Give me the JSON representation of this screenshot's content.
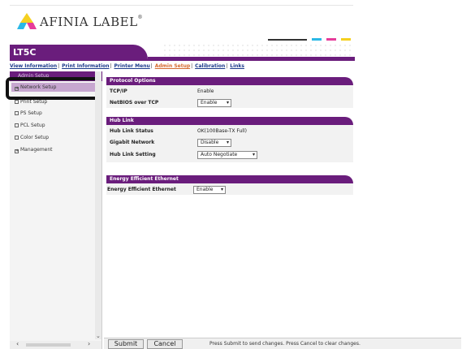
{
  "logo": {
    "text": "AFINIA LABEL",
    "tm": "®"
  },
  "header": {
    "title": "LT5C"
  },
  "colors": {
    "brand": "#6a1d7c",
    "selected": "#c7a7d0",
    "active_link": "#d46a2e",
    "cyan": "#2bb8e6",
    "magenta": "#e63c9a",
    "yellow": "#f5d020"
  },
  "topnav": {
    "items": [
      {
        "label": "View Information"
      },
      {
        "label": "Print Information"
      },
      {
        "label": "Printer Menu"
      },
      {
        "label": "Admin Setup"
      },
      {
        "label": "Calibration"
      },
      {
        "label": "Links"
      }
    ],
    "separator": "|"
  },
  "sidebar": {
    "heading": "Admin Setup",
    "items": [
      {
        "label": "Network Setup",
        "box": "+"
      },
      {
        "label": "Print Setup",
        "box": ""
      },
      {
        "label": "PS Setup",
        "box": ""
      },
      {
        "label": "PCL Setup",
        "box": ""
      },
      {
        "label": "Color Setup",
        "box": ""
      },
      {
        "label": "Management",
        "box": "+"
      }
    ]
  },
  "sections": {
    "protocol": {
      "title": "Protocol Options",
      "rows": [
        {
          "label": "TCP/IP",
          "value": "Enable"
        },
        {
          "label": "NetBIOS over TCP",
          "value": "Enable"
        }
      ]
    },
    "hub": {
      "title": "Hub Link",
      "rows": [
        {
          "label": "Hub Link Status",
          "value": "OK(100Base-TX Full)"
        },
        {
          "label": "Gigabit Network",
          "value": "Disable"
        },
        {
          "label": "Hub Link Setting",
          "value": "Auto Negotiate"
        }
      ]
    },
    "energy": {
      "title": "Energy Efficient Ethernet",
      "rows": [
        {
          "label": "Energy Efficient Ethernet",
          "value": "Enable"
        }
      ]
    }
  },
  "footer": {
    "submit": "Submit",
    "cancel": "Cancel",
    "hint": "Press Submit to send changes. Press Cancel to clear changes."
  },
  "scroll": {
    "down": "⌄",
    "left": "‹",
    "right": "›"
  }
}
